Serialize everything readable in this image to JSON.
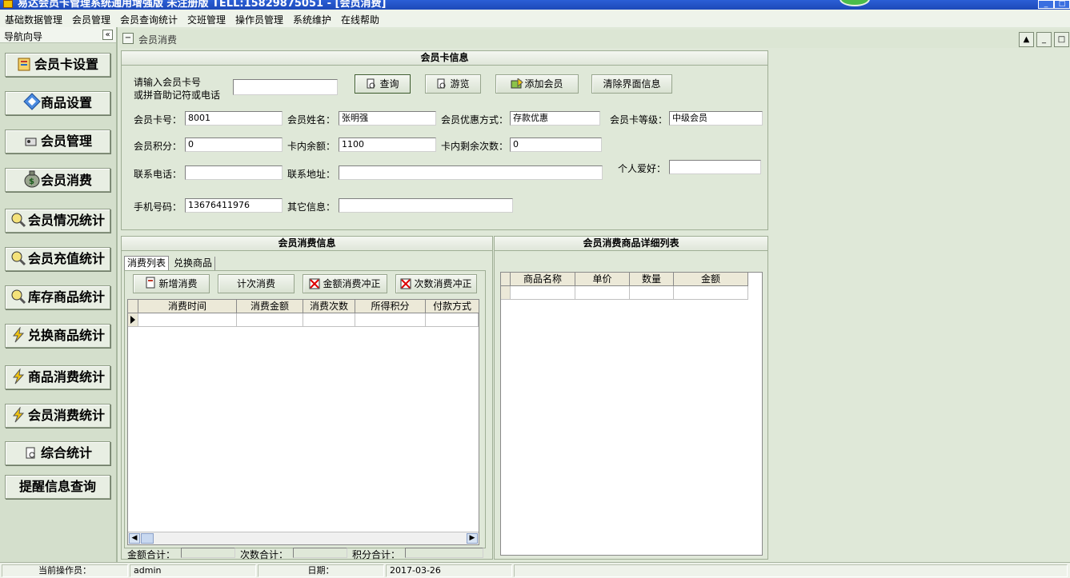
{
  "window": {
    "title": "易达会员卡管理系统通用增强版 未注册版 TELL:15829875051 - [会员消费]"
  },
  "menu": [
    "基础数据管理",
    "会员管理",
    "会员查询统计",
    "交班管理",
    "操作员管理",
    "系统维护",
    "在线帮助"
  ],
  "sidebar": {
    "header": "导航向导",
    "collapse": "«",
    "items": [
      {
        "label": "会员卡设置",
        "icon": "card-setting-icon"
      },
      {
        "label": "商品设置",
        "icon": "product-setting-icon"
      },
      {
        "label": "会员管理",
        "icon": "member-manage-icon"
      },
      {
        "label": "会员消费",
        "icon": "money-bag-icon"
      },
      {
        "label": "会员情况统计",
        "icon": "magnifier-chart-icon"
      },
      {
        "label": "会员充值统计",
        "icon": "magnifier-chart-icon"
      },
      {
        "label": "库存商品统计",
        "icon": "magnifier-chart-icon"
      },
      {
        "label": "兑换商品统计",
        "icon": "lightning-icon"
      },
      {
        "label": "商品消费统计",
        "icon": "lightning-icon"
      },
      {
        "label": "会员消费统计",
        "icon": "lightning-icon"
      },
      {
        "label": "综合统计",
        "icon": "document-search-icon"
      },
      {
        "label": "提醒信息查询",
        "icon": ""
      }
    ]
  },
  "child_window": {
    "title": "会员消费"
  },
  "card_info": {
    "title": "会员卡信息",
    "search_label_1": "请输入会员卡号",
    "search_label_2": "或拼音助记符或电话",
    "search_value": "",
    "buttons": {
      "query": "查询",
      "browse": "游览",
      "add_member": "添加会员",
      "clear": "清除界面信息"
    },
    "fields": {
      "card_no_label": "会员卡号：",
      "card_no": "8001",
      "name_label": "会员姓名：",
      "name": "张明强",
      "discount_label": "会员优惠方式：",
      "discount": "存款优惠",
      "level_label": "会员卡等级：",
      "level": "中级会员",
      "points_label": "会员积分：",
      "points": "0",
      "balance_label": "卡内余额：",
      "balance": "1100",
      "remaining_label": "卡内剩余次数：",
      "remaining": "0",
      "phone_label": "联系电话：",
      "phone": "",
      "address_label": "联系地址：",
      "address": "",
      "hobby_label": "个人爱好：",
      "hobby": "",
      "mobile_label": "手机号码：",
      "mobile": "13676411976",
      "other_label": "其它信息：",
      "other": ""
    }
  },
  "consumption": {
    "title": "会员消费信息",
    "tabs": [
      "消费列表",
      "兑换商品"
    ],
    "buttons": {
      "new": "新增消费",
      "count": "计次消费",
      "amount_reverse": "金额消费冲正",
      "count_reverse": "次数消费冲正"
    },
    "columns": [
      "消费时间",
      "消费金额",
      "消费次数",
      "所得积分",
      "付款方式"
    ],
    "totals": {
      "amount_label": "金额合计：",
      "amount": "",
      "count_label": "次数合计：",
      "count": "",
      "points_label": "积分合计：",
      "points": ""
    }
  },
  "detail": {
    "title": "会员消费商品详细列表",
    "columns": [
      "商品名称",
      "单价",
      "数量",
      "金额"
    ]
  },
  "statusbar": {
    "operator_label": "当前操作员：",
    "operator": "admin",
    "date_label": "日期：",
    "date": "2017-03-26"
  }
}
